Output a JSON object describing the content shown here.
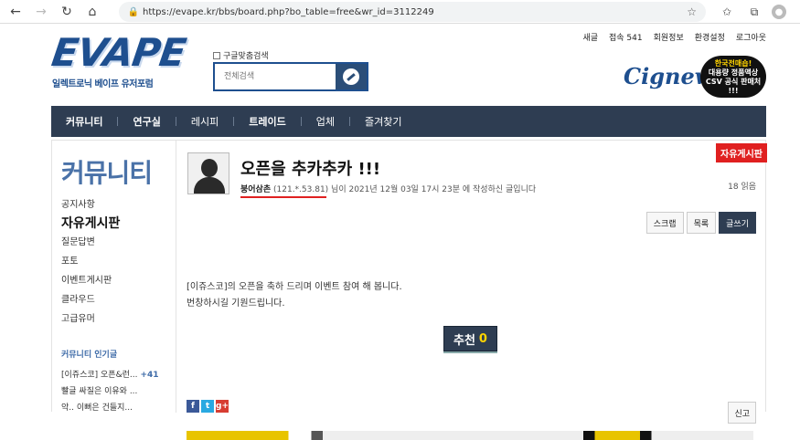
{
  "browser": {
    "url": "https://evape.kr/bbs/board.php?bo_table=free&wr_id=3112249"
  },
  "header": {
    "logo_main": "EVAPE",
    "logo_sub": "일렉트로닉 베이프 유저포럼",
    "search_checkbox_label": "구글맞춤검색",
    "search_placeholder": "전체검색",
    "toplinks": [
      "새글",
      "접속 541",
      "회원정보",
      "환경설정",
      "로그아웃"
    ],
    "banner_brand": "Cignew",
    "banner_line1": "한국전매숍!",
    "banner_line2": "대용량 정품액상",
    "banner_line3": "CSV 공식 판매처",
    "banner_line4": "!!!"
  },
  "nav": {
    "items": [
      "커뮤니티",
      "연구실",
      "레시피",
      "트레이드",
      "업체",
      "즐겨찾기"
    ]
  },
  "sidebar": {
    "title": "커뮤니티",
    "menu": [
      "공지사항",
      "자유게시판",
      "질문답변",
      "포토",
      "이벤트게시판",
      "클라우드",
      "고급유머"
    ],
    "popular_title": "커뮤니티 인기글",
    "popular": [
      {
        "text": "[이쥬스코] 오픈&런...",
        "count": "+41"
      },
      {
        "text": "빨글 싸질은 이유와 ...",
        "count": ""
      },
      {
        "text": "악.. 이뻐은 건들지...",
        "count": ""
      }
    ]
  },
  "post": {
    "board_badge": "자유게시판",
    "title": "오픈을 추카추카 !!!",
    "author": "붕어삼촌",
    "author_ip": "(121.*.53.81)",
    "meta_suffix": " 님이 2021년 12월 03일 17시 23분 에 작성하신 글입니다",
    "views": "18 읽음",
    "buttons": [
      "스크랩",
      "목록",
      "글쓰기"
    ],
    "body_line1": "[이쥬스코]의 오픈을 축하 드리며 이벤트 참여 해 봅니다.",
    "body_line2": "번창하시길 기원드립니다.",
    "recommend_label": "추천",
    "recommend_count": "0",
    "report_label": "신고"
  }
}
